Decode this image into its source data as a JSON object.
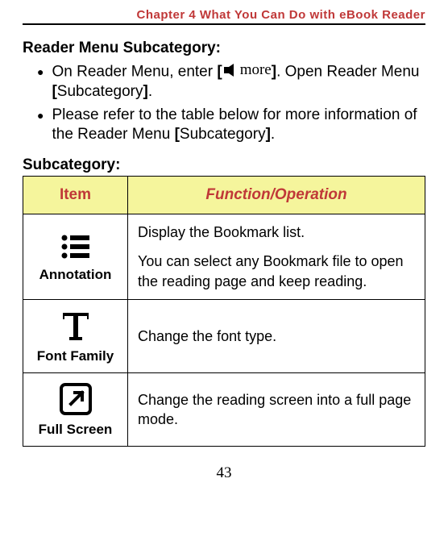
{
  "header": {
    "chapter_title": "Chapter 4 What You Can Do with eBook Reader"
  },
  "section1": {
    "title": "Reader Menu Subcategory:",
    "bullets": [
      {
        "pre": "On Reader Menu, enter ",
        "more_label": "more",
        "post1": ". Open Reader Menu ",
        "bracket1": "[",
        "sub": "Subcategory",
        "bracket2": "]",
        "tail": "."
      },
      {
        "text_a": "Please refer to the table below for more information of the Reader Menu ",
        "bracket1": "[",
        "sub": "Subcategory",
        "bracket2": "]",
        "tail": "."
      }
    ]
  },
  "subcategory_label": "Subcategory:",
  "table": {
    "headers": {
      "item": "Item",
      "func": "Function/Operation"
    },
    "rows": [
      {
        "icon": "list-icon",
        "label": "Annotation",
        "desc_p1": "Display the Bookmark list.",
        "desc_p2": "You can select any Bookmark file to open the reading page and keep reading."
      },
      {
        "icon": "font-icon",
        "label": "Font Family",
        "desc_p1": "Change the font type."
      },
      {
        "icon": "fullscreen-icon",
        "label": "Full Screen",
        "desc_p1": "Change the reading screen into a full page mode."
      }
    ]
  },
  "page_number": "43"
}
